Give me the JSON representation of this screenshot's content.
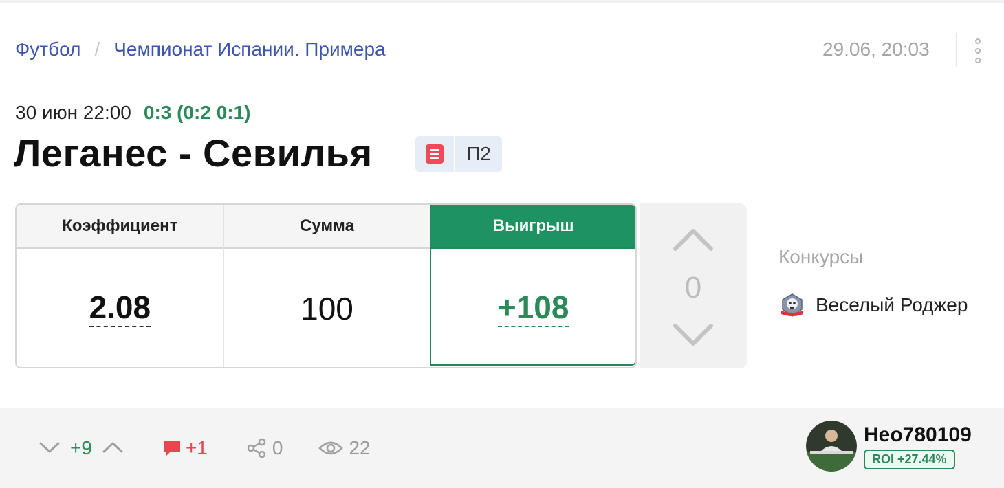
{
  "breadcrumb": {
    "sport": "Футбол",
    "separator": "/",
    "league": "Чемпионат Испании. Примера"
  },
  "post": {
    "timestamp": "29.06, 20:03"
  },
  "match": {
    "datetime": "30 июн 22:00",
    "score": "0:3 (0:2 0:1)",
    "title": "Леганес - Севилья",
    "bet_type": "П2"
  },
  "bet": {
    "headers": {
      "odds": "Коэффициент",
      "amount": "Сумма",
      "winnings": "Выигрыш"
    },
    "odds": "2.08",
    "amount": "100",
    "winnings": "+108"
  },
  "vote": {
    "count": "0"
  },
  "contests": {
    "label": "Конкурсы",
    "items": [
      {
        "name": "Веселый Роджер",
        "icon": "pirate-skull-badge-icon"
      }
    ]
  },
  "footer": {
    "rating": "+9",
    "comments": "+1",
    "shares": "0",
    "views": "22"
  },
  "author": {
    "name": "Нео780109",
    "roi": "ROI +27.44%"
  },
  "colors": {
    "link": "#3c55b0",
    "green": "#2c8a5a",
    "win_header": "#1e9361",
    "red": "#e8454f",
    "muted": "#a6a6a6"
  }
}
